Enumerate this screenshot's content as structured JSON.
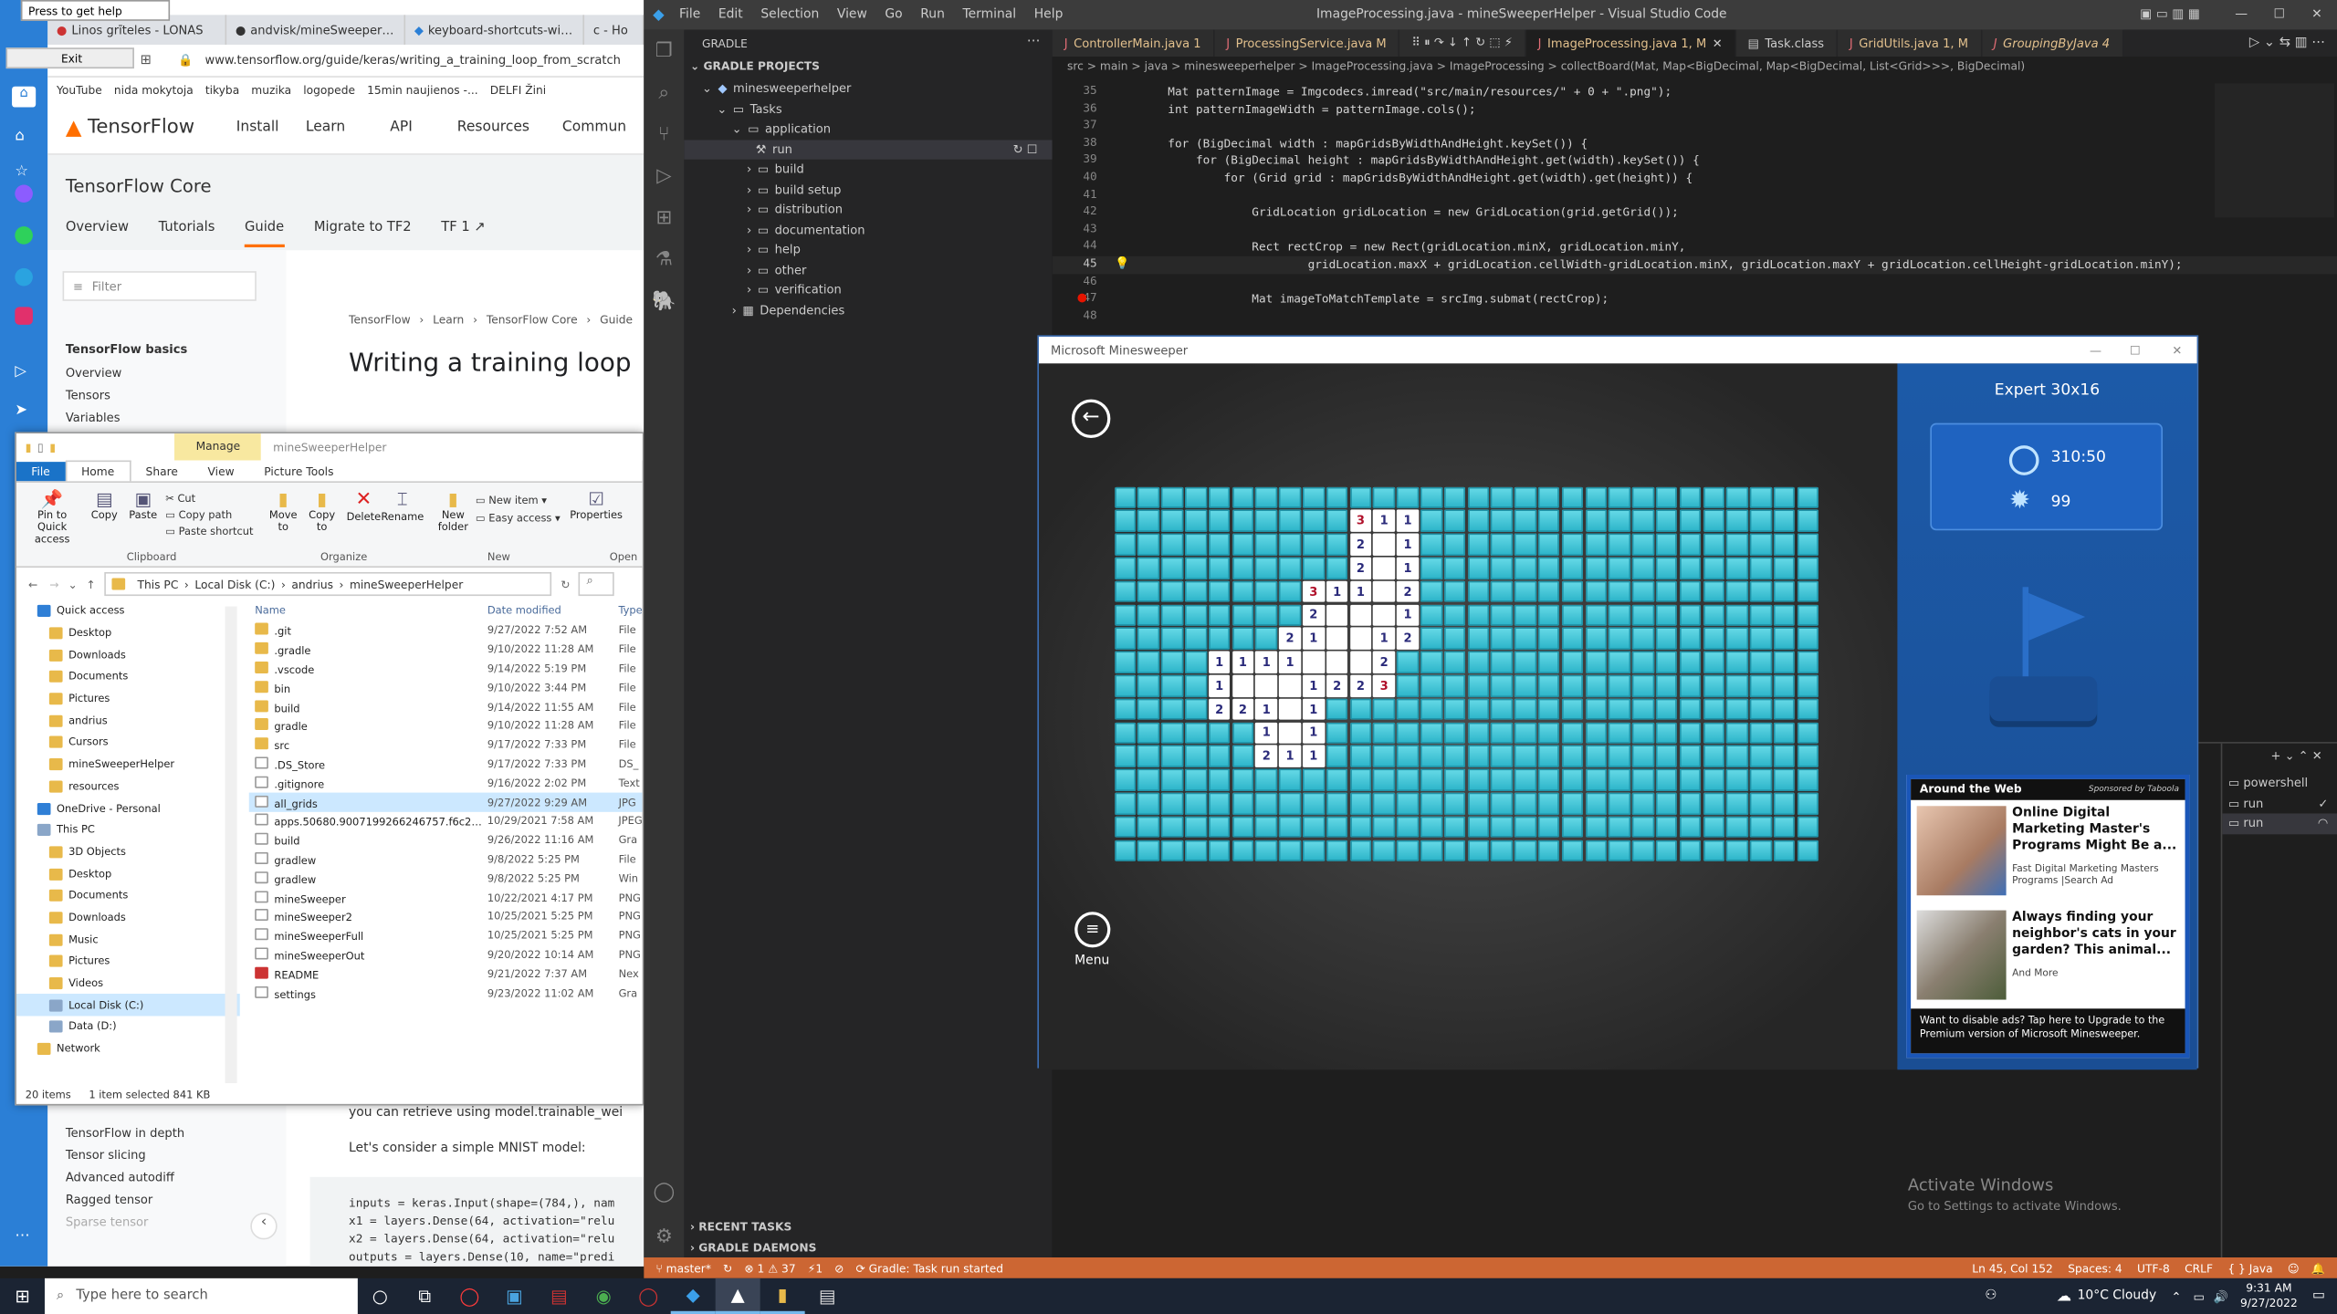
{
  "browser": {
    "tooltip": "Press to get help",
    "exit_label": "Exit",
    "tabs": [
      "Linos grīteles - LONAS",
      "andvisk/mineSweeperHelp",
      "keyboard-shortcuts-windo",
      "c - Ho"
    ],
    "url": "www.tensorflow.org/guide/keras/writing_a_training_loop_from_scratch",
    "bookmarks": [
      "YouTube",
      "nida mokytoja",
      "tikyba",
      "muzika",
      "logopede",
      "15min naujienos -...",
      "DELFI Žini"
    ],
    "nav": {
      "logo": "TensorFlow",
      "items": [
        "Install",
        "Learn",
        "API",
        "Resources",
        "Commun"
      ]
    },
    "sub_title": "TensorFlow Core",
    "sub_tabs": [
      "Overview",
      "Tutorials",
      "Guide",
      "Migrate to TF2",
      "TF 1 ↗"
    ],
    "filter_placeholder": "Filter",
    "side_items": [
      "TensorFlow basics",
      "Overview",
      "Tensors",
      "Variables"
    ],
    "side_bottom": [
      "TensorFlow in depth",
      "Tensor slicing",
      "Advanced autodiff",
      "Ragged tensor",
      "Sparse tensor"
    ],
    "breadcrumb": [
      "TensorFlow",
      "Learn",
      "TensorFlow Core",
      "Guide"
    ],
    "page_title": "Writing a training loop",
    "body_text1": "you can retrieve using model.trainable_wei",
    "body_text2": "Let's consider a simple MNIST model:",
    "code": [
      "inputs = keras.Input(shape=(784,), nam",
      "x1 = layers.Dense(64, activation=\"relu",
      "x2 = layers.Dense(64, activation=\"relu",
      "outputs = layers.Dense(10, name=\"predi"
    ]
  },
  "explorer": {
    "title": "mineSweeperHelper",
    "manage": "Manage",
    "ribbon_tabs": [
      "File",
      "Home",
      "Share",
      "View",
      "Picture Tools"
    ],
    "clipboard": [
      "Pin to Quick access",
      "Copy",
      "Paste",
      "Cut",
      "Copy path",
      "Paste shortcut"
    ],
    "organize": [
      "Move to",
      "Copy to",
      "Delete",
      "Rename"
    ],
    "new_group": [
      "New item",
      "Easy access",
      "New folder"
    ],
    "open_group": [
      "Properties"
    ],
    "groups": [
      "Clipboard",
      "Organize",
      "New",
      "Open"
    ],
    "path": [
      "This PC",
      "Local Disk (C:)",
      "andrius",
      "mineSweeperHelper"
    ],
    "nav_items": [
      "Quick access",
      "Desktop",
      "Downloads",
      "Documents",
      "Pictures",
      "andrius",
      "Cursors",
      "mineSweeperHelper",
      "resources",
      "OneDrive - Personal",
      "This PC",
      "3D Objects",
      "Desktop",
      "Documents",
      "Downloads",
      "Music",
      "Pictures",
      "Videos",
      "Local Disk (C:)",
      "Data (D:)",
      "Network"
    ],
    "col_name": "Name",
    "col_date": "Date modified",
    "col_type": "Type",
    "files": [
      {
        "name": ".git",
        "date": "9/27/2022 7:52 AM",
        "type": "File"
      },
      {
        "name": ".gradle",
        "date": "9/10/2022 11:28 AM",
        "type": "File"
      },
      {
        "name": ".vscode",
        "date": "9/14/2022 5:19 PM",
        "type": "File"
      },
      {
        "name": "bin",
        "date": "9/10/2022 3:44 PM",
        "type": "File"
      },
      {
        "name": "build",
        "date": "9/14/2022 11:55 AM",
        "type": "File"
      },
      {
        "name": "gradle",
        "date": "9/10/2022 11:28 AM",
        "type": "File"
      },
      {
        "name": "src",
        "date": "9/17/2022 7:33 PM",
        "type": "File"
      },
      {
        "name": ".DS_Store",
        "date": "9/17/2022 7:33 PM",
        "type": "DS_"
      },
      {
        "name": ".gitignore",
        "date": "9/16/2022 2:02 PM",
        "type": "Text"
      },
      {
        "name": "all_grids",
        "date": "9/27/2022 9:29 AM",
        "type": "JPG"
      },
      {
        "name": "apps.50680.9007199266246757.f6c29274-5...",
        "date": "10/29/2021 7:58 AM",
        "type": "JPEG"
      },
      {
        "name": "build",
        "date": "9/26/2022 11:16 AM",
        "type": "Gra"
      },
      {
        "name": "gradlew",
        "date": "9/8/2022 5:25 PM",
        "type": "File"
      },
      {
        "name": "gradlew",
        "date": "9/8/2022 5:25 PM",
        "type": "Win"
      },
      {
        "name": "mineSweeper",
        "date": "10/22/2021 4:17 PM",
        "type": "PNG"
      },
      {
        "name": "mineSweeper2",
        "date": "10/25/2021 5:25 PM",
        "type": "PNG"
      },
      {
        "name": "mineSweeperFull",
        "date": "10/25/2021 5:25 PM",
        "type": "PNG"
      },
      {
        "name": "mineSweeperOut",
        "date": "9/20/2022 10:14 AM",
        "type": "PNG"
      },
      {
        "name": "README",
        "date": "9/21/2022 7:37 AM",
        "type": "Nex"
      },
      {
        "name": "settings",
        "date": "9/23/2022 11:02 AM",
        "type": "Gra"
      }
    ],
    "status_left": "20 items",
    "status_mid": "1 item selected  841 KB"
  },
  "vscode": {
    "menu": [
      "File",
      "Edit",
      "Selection",
      "View",
      "Go",
      "Run",
      "Terminal",
      "Help"
    ],
    "title": "ImageProcessing.java - mineSweeperHelper - Visual Studio Code",
    "side_header": "GRADLE",
    "projects_header": "GRADLE PROJECTS",
    "tree": [
      "minesweeperhelper",
      "Tasks",
      "application",
      "run",
      "build",
      "build setup",
      "distribution",
      "documentation",
      "help",
      "other",
      "verification",
      "Dependencies"
    ],
    "recent": "RECENT TASKS",
    "daemons": "GRADLE DAEMONS",
    "tabs": [
      "ControllerMain.java 1",
      "ProcessingService.java M",
      "ImageProcessing.java 1, M",
      "Task.class",
      "GridUtils.java 1, M",
      "GroupingByJava 4"
    ],
    "breadcrumb": "src > main > java > minesweeperhelper > ImageProcessing.java > ImageProcessing > collectBoard(Mat, Map<BigDecimal, Map<BigDecimal, List<Grid>>>, BigDecimal)",
    "lines": [
      {
        "n": "35",
        "t": "        Mat patternImage = Imgcodecs.imread(\"src/main/resources/\" + 0 + \".png\");"
      },
      {
        "n": "36",
        "t": "        int patternImageWidth = patternImage.cols();"
      },
      {
        "n": "37",
        "t": ""
      },
      {
        "n": "38",
        "t": "        for (BigDecimal width : mapGridsByWidthAndHeight.keySet()) {"
      },
      {
        "n": "39",
        "t": "            for (BigDecimal height : mapGridsByWidthAndHeight.get(width).keySet()) {"
      },
      {
        "n": "40",
        "t": "                for (Grid grid : mapGridsByWidthAndHeight.get(width).get(height)) {"
      },
      {
        "n": "41",
        "t": ""
      },
      {
        "n": "42",
        "t": "                    GridLocation gridLocation = new GridLocation(grid.getGrid());"
      },
      {
        "n": "43",
        "t": ""
      },
      {
        "n": "44",
        "t": "                    Rect rectCrop = new Rect(gridLocation.minX, gridLocation.minY,"
      },
      {
        "n": "45",
        "t": "                            gridLocation.maxX + gridLocation.cellWidth-gridLocation.minX, gridLocation.maxY + gridLocation.cellHeight-gridLocation.minY);"
      },
      {
        "n": "46",
        "t": ""
      },
      {
        "n": "47",
        "t": "                    Mat imageToMatchTemplate = srcImg.submat(rectCrop);"
      },
      {
        "n": "48",
        "t": ""
      }
    ],
    "terminals": [
      "powershell",
      "run",
      "run"
    ],
    "watermark1": "Activate Windows",
    "watermark2": "Go to Settings to activate Windows.",
    "status_left": [
      "master*",
      "⊗ 1 ⚠ 37",
      "⚡1",
      "Gradle: Task run started"
    ],
    "status_right": [
      "Ln 45, Col 152",
      "Spaces: 4",
      "UTF-8",
      "CRLF",
      "{ } Java"
    ]
  },
  "minesweeper": {
    "title": "Microsoft Minesweeper",
    "mode": "Expert 30x16",
    "time": "310:50",
    "mines": "99",
    "menu_label": "Menu",
    "ad_header": "Around the Web",
    "ad_sponsor": "Sponsored by Taboola",
    "ads": [
      {
        "title": "Online Digital Marketing Master's Programs Might Be a...",
        "sub": "Fast Digital Marketing Masters Programs |Search Ad"
      },
      {
        "title": "Always finding your neighbor's cats in your garden? This animal...",
        "sub": "And More"
      }
    ],
    "ad_footer": "Want to disable ads? Tap here to Upgrade to the Premium version of Microsoft Minesweeper.",
    "grid_cols": 30,
    "grid_rows": 16,
    "opened": [
      [
        1,
        10,
        "3"
      ],
      [
        1,
        11,
        "1"
      ],
      [
        1,
        12,
        "1"
      ],
      [
        2,
        10,
        "2"
      ],
      [
        2,
        11,
        ""
      ],
      [
        2,
        12,
        "1"
      ],
      [
        3,
        10,
        "2"
      ],
      [
        3,
        11,
        ""
      ],
      [
        3,
        12,
        "1"
      ],
      [
        4,
        8,
        "3"
      ],
      [
        4,
        9,
        "1"
      ],
      [
        4,
        10,
        "1"
      ],
      [
        4,
        11,
        ""
      ],
      [
        4,
        12,
        "2"
      ],
      [
        5,
        8,
        "2"
      ],
      [
        5,
        9,
        ""
      ],
      [
        5,
        10,
        ""
      ],
      [
        5,
        11,
        ""
      ],
      [
        5,
        12,
        "1"
      ],
      [
        6,
        7,
        "2"
      ],
      [
        6,
        8,
        "1"
      ],
      [
        6,
        9,
        ""
      ],
      [
        6,
        10,
        ""
      ],
      [
        6,
        11,
        "1"
      ],
      [
        6,
        12,
        "2"
      ],
      [
        7,
        4,
        "1"
      ],
      [
        7,
        5,
        "1"
      ],
      [
        7,
        6,
        "1"
      ],
      [
        7,
        7,
        "1"
      ],
      [
        7,
        8,
        ""
      ],
      [
        7,
        9,
        ""
      ],
      [
        7,
        10,
        ""
      ],
      [
        7,
        11,
        "2"
      ],
      [
        8,
        4,
        "1"
      ],
      [
        8,
        5,
        ""
      ],
      [
        8,
        6,
        ""
      ],
      [
        8,
        7,
        ""
      ],
      [
        8,
        8,
        "1"
      ],
      [
        8,
        9,
        "2"
      ],
      [
        8,
        10,
        "2"
      ],
      [
        8,
        11,
        "3"
      ],
      [
        9,
        4,
        "2"
      ],
      [
        9,
        5,
        "2"
      ],
      [
        9,
        6,
        "1"
      ],
      [
        9,
        7,
        ""
      ],
      [
        9,
        8,
        "1"
      ],
      [
        10,
        6,
        "1"
      ],
      [
        10,
        7,
        ""
      ],
      [
        10,
        8,
        "1"
      ],
      [
        11,
        6,
        "2"
      ],
      [
        11,
        7,
        "1"
      ],
      [
        11,
        8,
        "1"
      ]
    ]
  },
  "taskbar": {
    "search_placeholder": "Type here to search",
    "weather": "10°C  Cloudy",
    "time": "9:31 AM",
    "date": "9/27/2022"
  }
}
